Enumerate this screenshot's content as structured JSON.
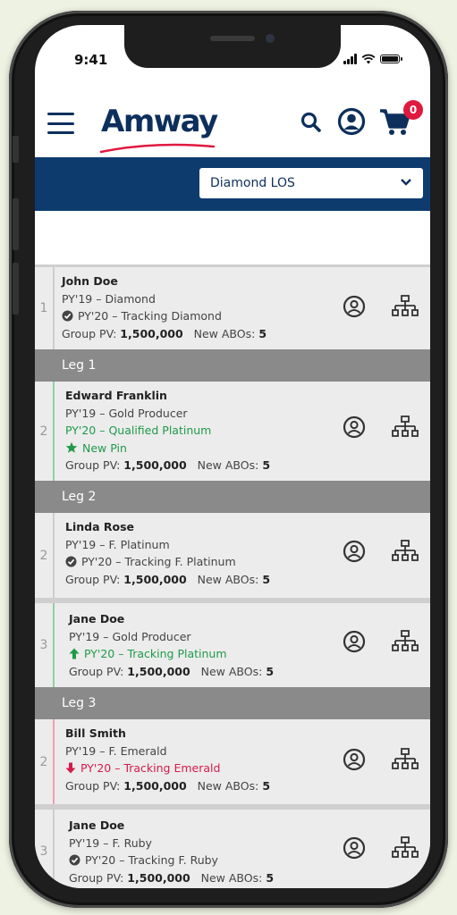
{
  "status": {
    "time": "9:41"
  },
  "header": {
    "logo": "Amway",
    "cart_count": "0"
  },
  "selector": {
    "value": "Diamond LOS"
  },
  "labels": {
    "group_pv": "Group PV:",
    "new_abos": "New ABOs:"
  },
  "cards": [
    {
      "rank": "1",
      "name": "John Doe",
      "py19": "PY'19 – Diamond",
      "py20": "PY'20 – Tracking Diamond",
      "py20_style": "check",
      "extra": "",
      "group_pv": "1,500,000",
      "new_abos": "5"
    },
    {
      "rank": "2",
      "name": "Edward Franklin",
      "py19": "PY'19 – Gold Producer",
      "py20": "PY'20 – Qualified Platinum",
      "py20_style": "green",
      "extra": "New Pin",
      "group_pv": "1,500,000",
      "new_abos": "5"
    },
    {
      "rank": "2",
      "name": "Linda Rose",
      "py19": "PY'19 – F. Platinum",
      "py20": "PY'20 – Tracking F. Platinum",
      "py20_style": "check",
      "extra": "",
      "group_pv": "1,500,000",
      "new_abos": "5"
    },
    {
      "rank": "3",
      "name": "Jane Doe",
      "py19": "PY'19 – Gold Producer",
      "py20": "PY'20 – Tracking Platinum",
      "py20_style": "up",
      "extra": "",
      "group_pv": "1,500,000",
      "new_abos": "5"
    },
    {
      "rank": "2",
      "name": "Bill Smith",
      "py19": "PY'19 – F. Emerald",
      "py20": "PY'20 – Tracking Emerald",
      "py20_style": "down",
      "extra": "",
      "group_pv": "1,500,000",
      "new_abos": "5"
    },
    {
      "rank": "3",
      "name": "Jane Doe",
      "py19": "PY'19 – F. Ruby",
      "py20": "PY'20 – Tracking F. Ruby",
      "py20_style": "check",
      "extra": "",
      "group_pv": "1,500,000",
      "new_abos": "5"
    }
  ],
  "legs": [
    "Leg 1",
    "Leg 2",
    "Leg 3"
  ],
  "colors": {
    "navy": "#0d3b6e",
    "badge": "#e0193f",
    "green": "#1f9a4a",
    "red": "#d41c4c",
    "leg_bar": "#8a8a8a"
  }
}
